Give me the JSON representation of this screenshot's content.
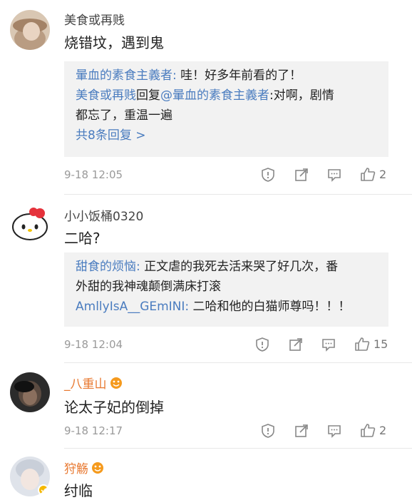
{
  "comments": [
    {
      "username": "美食或再贱",
      "text": "烧错坟，遇到鬼",
      "replies": [
        {
          "parts": [
            {
              "t": "暈血的素食主義者:",
              "blue": true
            },
            {
              "t": " 哇！好多年前看的了！",
              "blue": false
            }
          ]
        },
        {
          "parts": [
            {
              "t": "美食或再贱",
              "blue": true
            },
            {
              "t": "回复",
              "blue": false
            },
            {
              "t": "@暈血的素食主義者",
              "blue": true
            },
            {
              "t": ":对啊，剧情",
              "blue": false
            }
          ]
        },
        {
          "parts": [
            {
              "t": "都忘了，重温一遍",
              "blue": false
            }
          ]
        },
        {
          "parts": [
            {
              "t": "共8条回复 >",
              "blue": true
            }
          ]
        }
      ],
      "time": "9-18 12:05",
      "likes": "2"
    },
    {
      "username": "小小饭桶0320",
      "text": "二哈?",
      "replies": [
        {
          "parts": [
            {
              "t": "甜食的烦恼:",
              "blue": true
            },
            {
              "t": " 正文虐的我死去活来哭了好几次，番",
              "blue": false
            }
          ]
        },
        {
          "parts": [
            {
              "t": "外甜的我神魂颠倒满床打滚",
              "blue": false
            }
          ]
        },
        {
          "parts": [
            {
              "t": "AmllyIsA__GEmINI:",
              "blue": true
            },
            {
              "t": " 二哈和他的白猫师尊吗！！！",
              "blue": false
            }
          ]
        }
      ],
      "time": "9-18 12:04",
      "likes": "15"
    },
    {
      "username": "_八重山",
      "text": "论太子妃的倒掉",
      "time": "9-18 12:17",
      "likes": "2"
    },
    {
      "username": "狩觞",
      "text": "纣临"
    }
  ],
  "colors": {
    "link": "#4a7cbf",
    "username_vip": "#e8772e",
    "meta": "#9a9a9a",
    "reply_bg": "#f2f2f2"
  }
}
